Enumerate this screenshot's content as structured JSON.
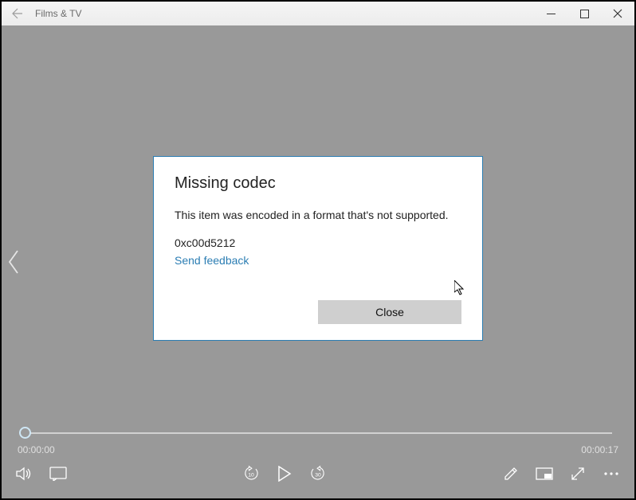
{
  "titlebar": {
    "title": "Films & TV"
  },
  "dialog": {
    "title": "Missing codec",
    "message": "This item was encoded in a format that's not supported.",
    "code": "0xc00d5212",
    "feedback_link": "Send feedback",
    "close_label": "Close"
  },
  "player": {
    "current_time": "00:00:00",
    "duration": "00:00:17",
    "skip_back_seconds": "10",
    "skip_forward_seconds": "30"
  }
}
